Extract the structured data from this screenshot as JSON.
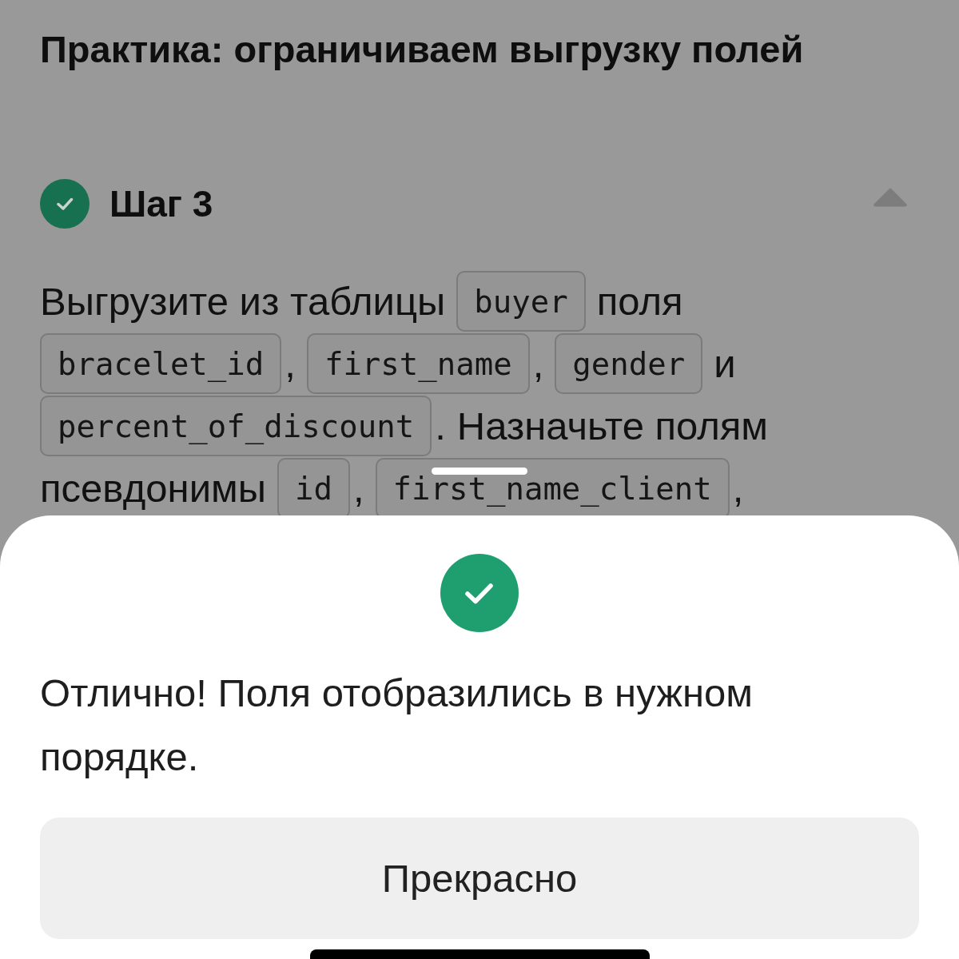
{
  "page": {
    "title": "Практика: ограничиваем выгрузку полей"
  },
  "step": {
    "title": "Шаг 3",
    "completed": true,
    "expanded": true
  },
  "task": {
    "lines": [
      [
        {
          "kind": "text",
          "text": "Выгрузите из таблицы"
        },
        {
          "kind": "code",
          "text": "buyer"
        },
        {
          "kind": "text",
          "text": "поля"
        }
      ],
      [
        {
          "kind": "code",
          "text": "bracelet_id"
        },
        {
          "kind": "punct",
          "text": ","
        },
        {
          "kind": "code",
          "text": "first_name"
        },
        {
          "kind": "punct",
          "text": ","
        },
        {
          "kind": "code",
          "text": "gender"
        },
        {
          "kind": "text",
          "text": "и"
        }
      ],
      [
        {
          "kind": "code",
          "text": "percent_of_discount"
        },
        {
          "kind": "punct",
          "text": "."
        },
        {
          "kind": "text",
          "text": "Назначьте полям"
        }
      ],
      [
        {
          "kind": "text",
          "text": "псевдонимы"
        },
        {
          "kind": "code",
          "text": "id"
        },
        {
          "kind": "punct",
          "text": ","
        },
        {
          "kind": "code",
          "text": "first_name_client"
        },
        {
          "kind": "punct",
          "text": ","
        }
      ]
    ]
  },
  "sheet": {
    "message": "Отлично! Поля отобразились в нужном порядке.",
    "button": "Прекрасно"
  }
}
